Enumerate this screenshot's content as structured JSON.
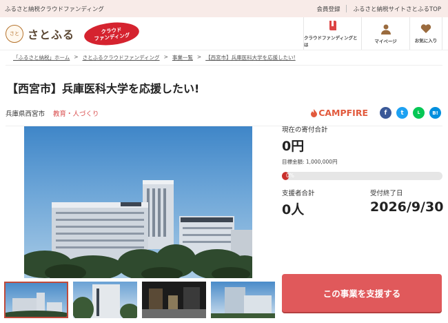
{
  "topbar": {
    "site_label": "ふるさと納税クラウドファンディング",
    "register": "会員登録",
    "top_link": "ふるさと納税サイトさとふるTOP"
  },
  "header": {
    "logo_text": "さとふる",
    "logo_mark": "さと",
    "badge_line1": "クラウド",
    "badge_line2": "ファンディング",
    "nav": [
      {
        "label": "クラウドファンディングとは",
        "icon": "book-icon"
      },
      {
        "label": "マイページ",
        "icon": "person-icon"
      },
      {
        "label": "お気に入り",
        "icon": "heart-icon"
      }
    ]
  },
  "breadcrumb": [
    "「ふるさと納税」ホーム",
    "さとふるクラウドファンディング",
    "事業一覧",
    "【西宮市】兵庫医科大学を応援したい!"
  ],
  "project": {
    "title": "【西宮市】兵庫医科大学を応援したい!",
    "location": "兵庫県西宮市",
    "category": "教育・人づくり",
    "partner": "CAMPFIRE"
  },
  "share": [
    {
      "name": "facebook",
      "glyph": "f",
      "color": "#3b5998"
    },
    {
      "name": "twitter",
      "glyph": "t",
      "color": "#1da1f2"
    },
    {
      "name": "line",
      "glyph": "L",
      "color": "#06c755"
    },
    {
      "name": "hatena",
      "glyph": "B!",
      "color": "#008fde"
    }
  ],
  "funding": {
    "current_label": "現在の寄付合計",
    "current_value": "0円",
    "goal_text": "目標金額: 1,000,000円",
    "progress_text": "0%",
    "progress_fraction": 0.0,
    "supporters_label": "支援者合計",
    "supporters_value": "0人",
    "deadline_label": "受付終了日",
    "deadline_value": "2026/9/30",
    "cta_label": "この事業を支援する"
  },
  "colors": {
    "accent": "#e0595b",
    "progress": "#c9302c",
    "topbar_bg": "#f8ebe8"
  }
}
